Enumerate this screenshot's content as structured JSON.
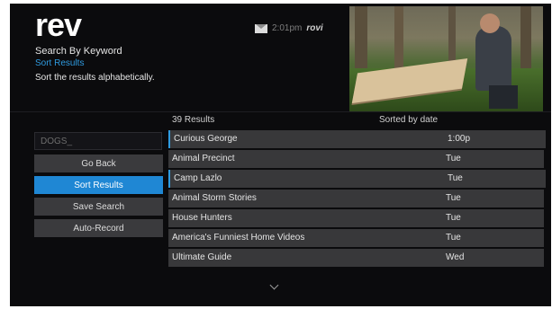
{
  "header": {
    "logo": "rev",
    "breadcrumb_title": "Search By Keyword",
    "breadcrumb_sub": "Sort Results",
    "help_text": "Sort the results alphabetically.",
    "clock": "2:01pm",
    "brand": "rovi"
  },
  "results": {
    "count_label": "39 Results",
    "sort_label": "Sorted by date",
    "rows": [
      {
        "title": "Curious George",
        "time": "1:00p"
      },
      {
        "title": "Animal Precinct",
        "time": "Tue"
      },
      {
        "title": "Camp Lazlo",
        "time": "Tue"
      },
      {
        "title": "Animal Storm Stories",
        "time": "Tue"
      },
      {
        "title": "House Hunters",
        "time": "Tue"
      },
      {
        "title": "America's Funniest Home Videos",
        "time": "Tue"
      },
      {
        "title": "Ultimate Guide",
        "time": "Wed"
      }
    ]
  },
  "sidebar": {
    "search_value": "DOGS_",
    "buttons": [
      {
        "label": "Go Back"
      },
      {
        "label": "Sort Results"
      },
      {
        "label": "Save Search"
      },
      {
        "label": "Auto-Record"
      }
    ]
  },
  "colors": {
    "accent": "#1f87d4",
    "background": "#0b0b0d",
    "row": "#38383a"
  },
  "icons": [
    "mail-icon",
    "chevron-down-icon"
  ]
}
